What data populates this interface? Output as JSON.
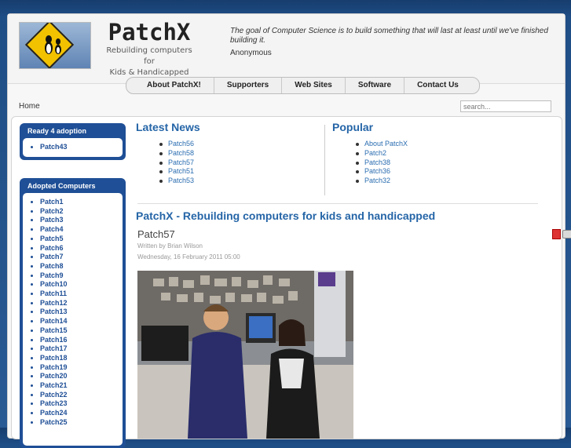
{
  "header": {
    "brand_title": "PatchX",
    "brand_sub_line1": "Rebuilding computers for",
    "brand_sub_line2": "Kids & Handicapped",
    "quote": "The goal of Computer Science is to build something that will last at least until we've finished building it.",
    "quote_author": "Anonymous"
  },
  "nav": {
    "items": [
      "About PatchX!",
      "Supporters",
      "Web Sites",
      "Software",
      "Contact Us"
    ]
  },
  "breadcrumb": "Home",
  "search": {
    "placeholder": "search..."
  },
  "sidebar": {
    "ready": {
      "title": "Ready 4 adoption",
      "items": [
        "Patch43"
      ]
    },
    "adopted": {
      "title": "Adopted Computers",
      "items": [
        "Patch1",
        "Patch2",
        "Patch3",
        "Patch4",
        "Patch5",
        "Patch6",
        "Patch7",
        "Patch8",
        "Patch9",
        "Patch10",
        "Patch11",
        "Patch12",
        "Patch13",
        "Patch14",
        "Patch15",
        "Patch16",
        "Patch17",
        "Patch18",
        "Patch19",
        "Patch20",
        "Patch21",
        "Patch22",
        "Patch23",
        "Patch24",
        "Patch25"
      ]
    }
  },
  "latest_news": {
    "title": "Latest News",
    "items": [
      "Patch56",
      "Patch58",
      "Patch57",
      "Patch51",
      "Patch53"
    ]
  },
  "popular": {
    "title": "Popular",
    "items": [
      "About PatchX",
      "Patch2",
      "Patch38",
      "Patch36",
      "Patch32"
    ]
  },
  "main": {
    "heading": "PatchX - Rebuilding computers for kids and handicapped",
    "article_title": "Patch57",
    "author": "Written by Brian Wilson",
    "date": "Wednesday, 16 February 2011 05:00"
  },
  "icons": {
    "pdf": "pdf-icon",
    "print": "print-icon",
    "logo": "penguin-road-sign-logo"
  },
  "colors": {
    "accent": "#2565a7",
    "module": "#1f4f96",
    "background": "#1f4d86"
  }
}
